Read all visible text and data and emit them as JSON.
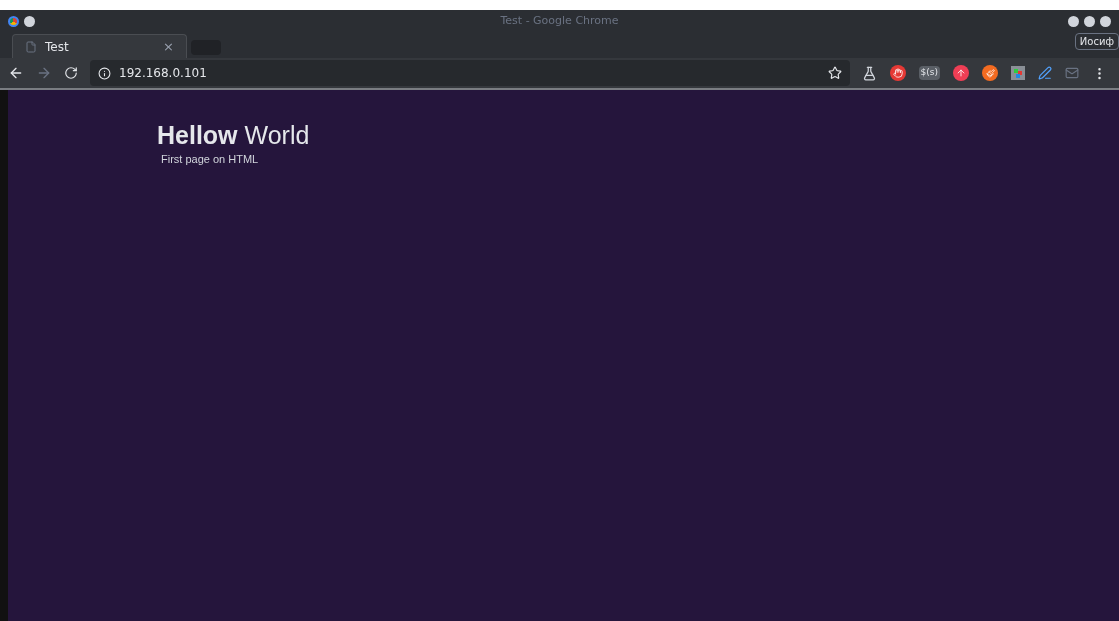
{
  "window": {
    "title": "Test - Google Chrome",
    "profile": "Иосиф"
  },
  "tabs": [
    {
      "label": "Test",
      "close": "×",
      "selected": true
    }
  ],
  "address_bar": {
    "url": "192.168.0.101"
  },
  "extensions": [
    {
      "kind": "flask"
    },
    {
      "kind": "stop",
      "color": "#e53935"
    },
    {
      "kind": "text",
      "label": "$(s)"
    },
    {
      "kind": "arrow",
      "color": "#ef3e55"
    },
    {
      "kind": "brush",
      "color": "#f36b21"
    },
    {
      "kind": "grid"
    },
    {
      "kind": "pen"
    },
    {
      "kind": "mail"
    }
  ],
  "page": {
    "heading": "**Hellow** World",
    "subtitle": "First page on HTML"
  }
}
